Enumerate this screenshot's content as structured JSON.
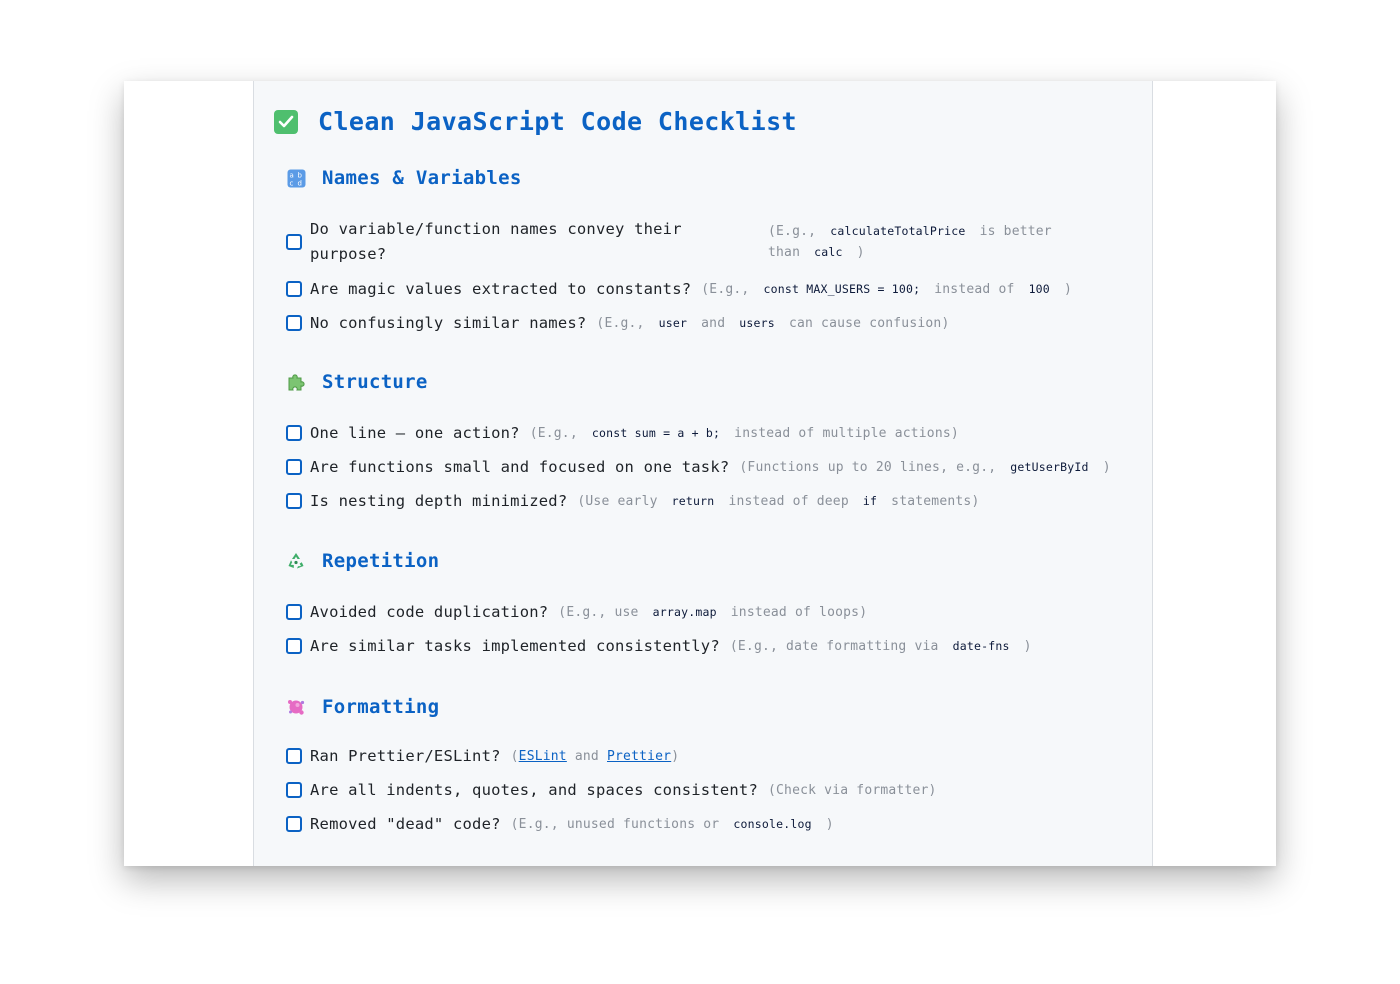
{
  "title": "Clean JavaScript Code Checklist",
  "icons": {
    "title": "check-box-icon",
    "names": "abcd-letters-icon",
    "structure": "puzzle-piece-icon",
    "repetition": "recycle-icon",
    "formatting": "paint-splash-icon"
  },
  "colors": {
    "accent": "#0b62c4",
    "check_green": "#4fbf6e",
    "doc_bg": "#f6f8fa"
  },
  "sections": [
    {
      "title": "Names & Variables",
      "items": [
        {
          "question": "Do variable/function names convey their purpose?",
          "hint_pre": "(E.g.,",
          "code1": "calculateTotalPrice",
          "hint_mid": "is better than",
          "code2": "calc",
          "hint_post": ")"
        },
        {
          "question": "Are magic values extracted to constants?",
          "hint_pre": "(E.g.,",
          "code1": "const MAX_USERS = 100;",
          "hint_mid": "instead of",
          "code2": "100",
          "hint_post": ")"
        },
        {
          "question": "No confusingly similar names?",
          "hint_pre": "(E.g.,",
          "code1": "user",
          "hint_mid": "and",
          "code2": "users",
          "hint_post": "can cause confusion)"
        }
      ]
    },
    {
      "title": "Structure",
      "items": [
        {
          "question": "One line — one action?",
          "hint_pre": "(E.g.,",
          "code1": "const sum = a + b;",
          "hint_post": "instead of multiple actions)"
        },
        {
          "question": "Are functions small and focused on one task?",
          "hint_pre": "(Functions up to 20 lines, e.g.,",
          "code1": "getUserById",
          "hint_post": ")"
        },
        {
          "question": "Is nesting depth minimized?",
          "hint_pre": "(Use early",
          "code1": "return",
          "hint_mid": "instead of deep",
          "code2": "if",
          "hint_post": "statements)"
        }
      ]
    },
    {
      "title": "Repetition",
      "items": [
        {
          "question": "Avoided code duplication?",
          "hint_pre": "(E.g., use",
          "code1": "array.map",
          "hint_post": "instead of loops)"
        },
        {
          "question": "Are similar tasks implemented consistently?",
          "hint_pre": "(E.g., date formatting via",
          "code1": "date-fns",
          "hint_post": ")"
        }
      ]
    },
    {
      "title": "Formatting",
      "items": [
        {
          "question": "Ran Prettier/ESLint?",
          "hint_pre": "(",
          "link1": "ESLint",
          "hint_mid": "and",
          "link2": "Prettier",
          "hint_post": ")"
        },
        {
          "question": "Are all indents, quotes, and spaces consistent?",
          "hint_pre": "(Check via formatter)"
        },
        {
          "question": "Removed \"dead\" code?",
          "hint_pre": "(E.g., unused functions or",
          "code1": "console.log",
          "hint_post": ")"
        }
      ]
    }
  ]
}
